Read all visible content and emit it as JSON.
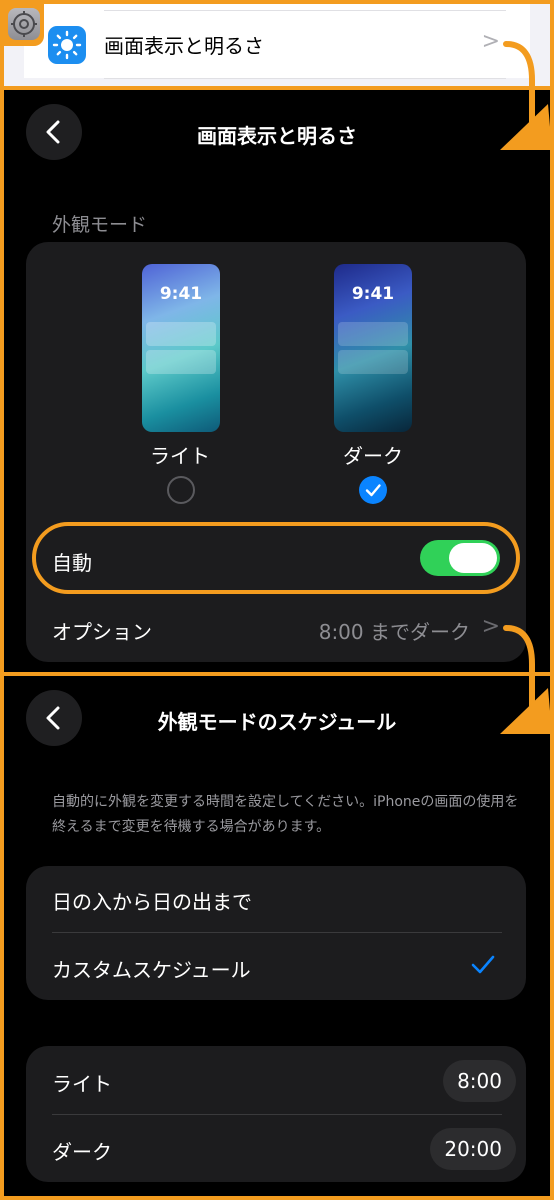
{
  "panel_settings": {
    "row_label": "画面表示と明るさ",
    "row_chevron": ">",
    "settings_icon": "gear-icon",
    "row_icon": "sun-icon"
  },
  "panel_display": {
    "title": "画面表示と明るさ",
    "section_label": "外観モード",
    "light": {
      "label": "ライト",
      "preview_time": "9:41",
      "selected": false
    },
    "dark": {
      "label": "ダーク",
      "preview_time": "9:41",
      "selected": true
    },
    "auto": {
      "label": "自動",
      "toggle_on": true
    },
    "options": {
      "label": "オプション",
      "value": "8:00 までダーク",
      "chevron": ">"
    }
  },
  "panel_schedule": {
    "title": "外観モードのスケジュール",
    "description": "自動的に外観を変更する時間を設定してください。iPhoneの画面の使用を終えるまで変更を待機する場合があります。",
    "mode_options": [
      {
        "label": "日の入から日の出まで",
        "selected": false
      },
      {
        "label": "カスタムスケジュール",
        "selected": true
      }
    ],
    "times": [
      {
        "label": "ライト",
        "value": "8:00"
      },
      {
        "label": "ダーク",
        "value": "20:00"
      }
    ]
  },
  "colors": {
    "highlight_orange": "#f39c1f",
    "accent_blue": "#0a84ff",
    "toggle_green": "#30d158"
  }
}
